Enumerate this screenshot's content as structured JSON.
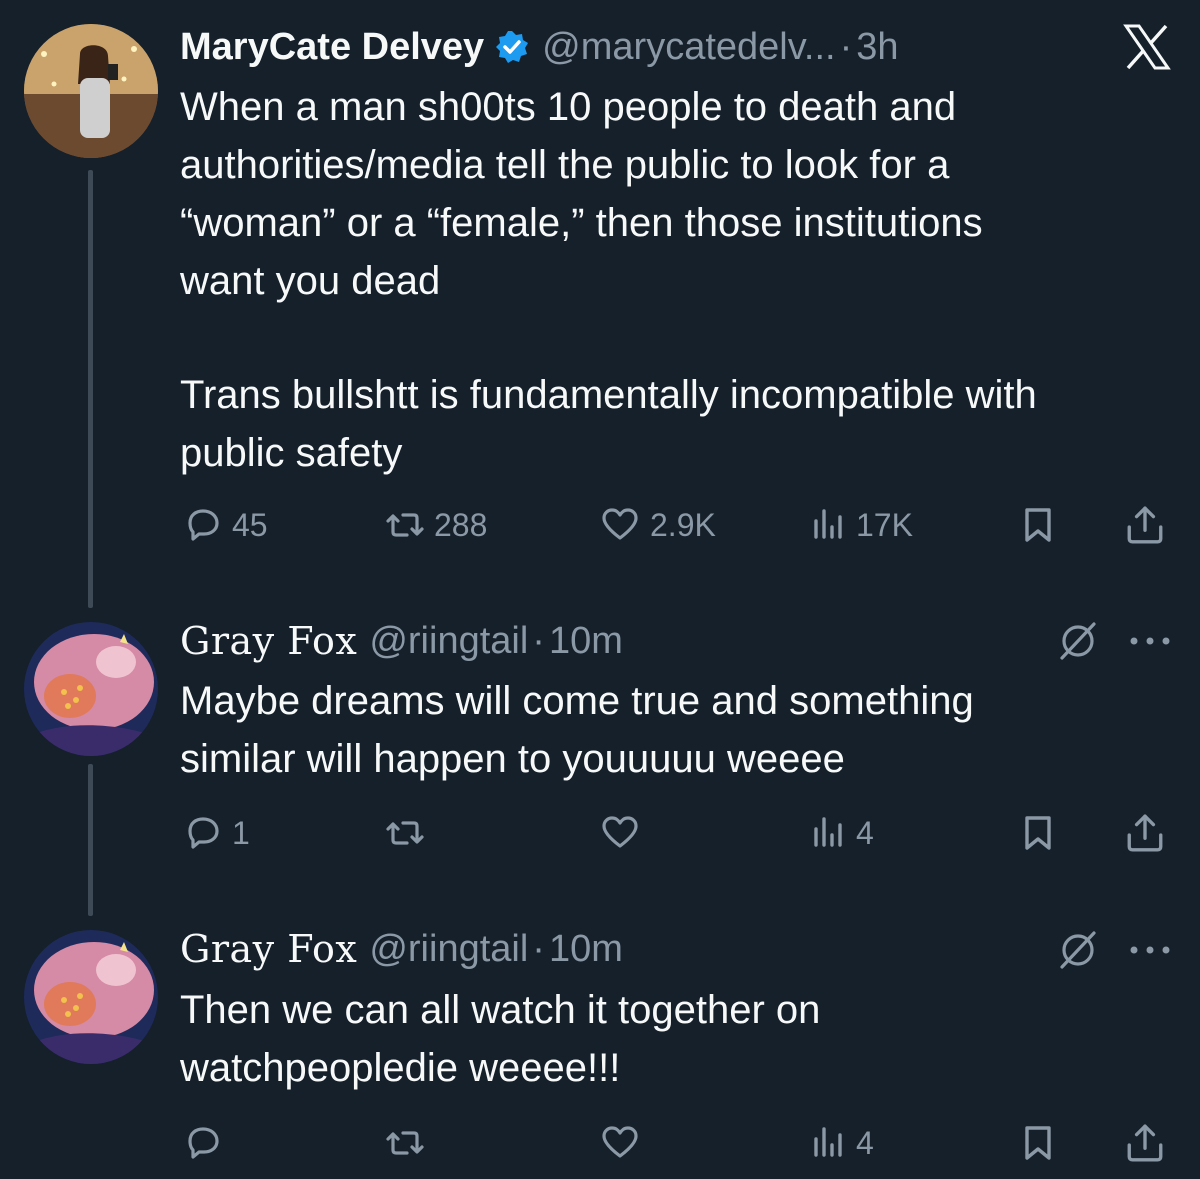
{
  "colors": {
    "background": "#15202b",
    "text_primary": "#f7f9f9",
    "text_secondary": "#8b98a5",
    "verified_blue": "#1d9bf0",
    "thread_line": "#3e4a56"
  },
  "app": {
    "logo_icon": "x-logo-icon"
  },
  "tweets": [
    {
      "author": "MaryCate Delvey",
      "verified": true,
      "handle": "@marycatedelv...",
      "separator": "·",
      "time": "3h",
      "text_p1": "When a man sh00ts 10 people to death and\nauthorities/media tell the public to look for a\n“woman” or a “female,” then those institutions\nwant you dead",
      "text_p2": "Trans bullshtt is fundamentally incompatible with\npublic safety",
      "replies": "45",
      "reposts": "288",
      "likes": "2.9K",
      "views": "17K"
    },
    {
      "author": "Gray Fox",
      "handle": "@riingtail",
      "separator": "·",
      "time": "10m",
      "text": "Maybe dreams will come true and something\nsimilar will happen to youuuuu weeee",
      "replies": "1",
      "reposts": "",
      "likes": "",
      "views": "4"
    },
    {
      "author": "Gray Fox",
      "handle": "@riingtail",
      "separator": "·",
      "time": "10m",
      "text": "Then we can all watch it together on\nwatchpeopledie weeee!!!",
      "replies": "",
      "reposts": "",
      "likes": "",
      "views": "4"
    }
  ]
}
